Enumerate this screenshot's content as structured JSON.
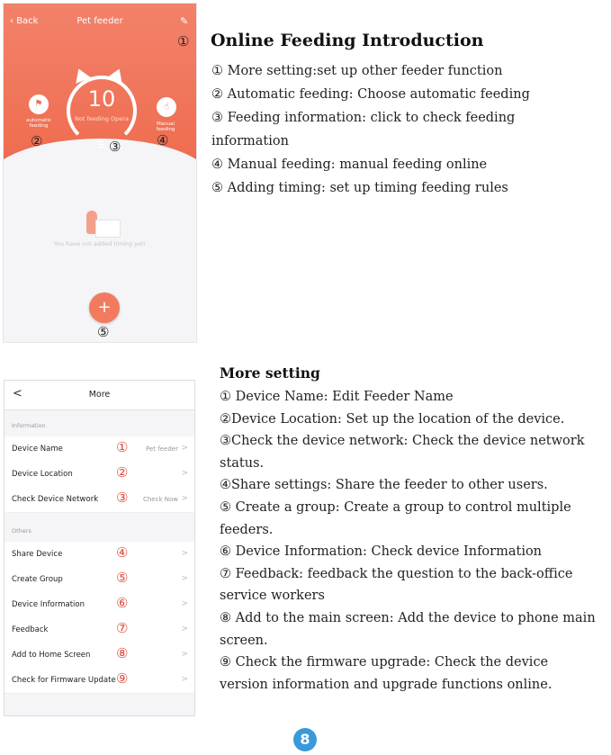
{
  "feeder_screen": {
    "back_label": "Back",
    "title": "Pet feeder",
    "pencil_icon": "pencil-icon",
    "marker_1": "①",
    "ring_number": "10",
    "ring_subtext": "Not feeding Opera",
    "auto_label": "automatic feeding",
    "marker_2": "②",
    "manual_label": "Manual feeding",
    "marker_4": "④",
    "list_icon": "☰",
    "marker_3": "③",
    "empty_message": "You have not added timing yet!",
    "add_button": "+",
    "marker_5": "⑤"
  },
  "intro": {
    "title": "Online Feeding Introduction",
    "lines": [
      "① More setting:set up other feeder function",
      "②  Automatic feeding: Choose automatic feeding",
      "③ Feeding information: click to check feeding",
      "information",
      "④  Manual feeding: manual feeding online",
      "⑤ Adding timing: set up timing feeding rules"
    ]
  },
  "more_screen": {
    "back": "<",
    "title": "More",
    "section_information": "Information",
    "section_others": "Others",
    "rows_information": [
      {
        "label": "Device Name",
        "mark": "①",
        "value": "Pet feeder"
      },
      {
        "label": "Device Location",
        "mark": "②",
        "value": ""
      },
      {
        "label": "Check Device Network",
        "mark": "③",
        "value": "Check Now"
      }
    ],
    "rows_others": [
      {
        "label": "Share Device",
        "mark": "④",
        "value": ""
      },
      {
        "label": "Create Group",
        "mark": "⑤",
        "value": ""
      },
      {
        "label": "Device Information",
        "mark": "⑥",
        "value": ""
      },
      {
        "label": "Feedback",
        "mark": "⑦",
        "value": ""
      },
      {
        "label": "Add to Home Screen",
        "mark": "⑧",
        "value": ""
      },
      {
        "label": "Check for Firmware Update",
        "mark": "⑨",
        "value": ""
      }
    ],
    "chevron": ">"
  },
  "more_text": {
    "title": "More setting",
    "lines": [
      "① Device Name:  Edit Feeder Name",
      "②Device Location: Set up the location of the device.",
      "③Check the device network: Check the device network",
      "status.",
      "④Share settings: Share the feeder to other users.",
      "⑤ Create a group: Create a group to control multiple",
      "feeders.",
      "⑥ Device Information: Check device Information",
      "⑦ Feedback:  feedback the question to the back-office",
      "service workers",
      "⑧ Add to the main screen: Add the device to phone main",
      "screen.",
      "⑨ Check the firmware upgrade: Check the device",
      "version information and upgrade functions online."
    ]
  },
  "page_number": "8",
  "colors": {
    "accent": "#ef6c4f",
    "marker_red": "#e04a3a",
    "page_badge": "#3a9ad9"
  }
}
